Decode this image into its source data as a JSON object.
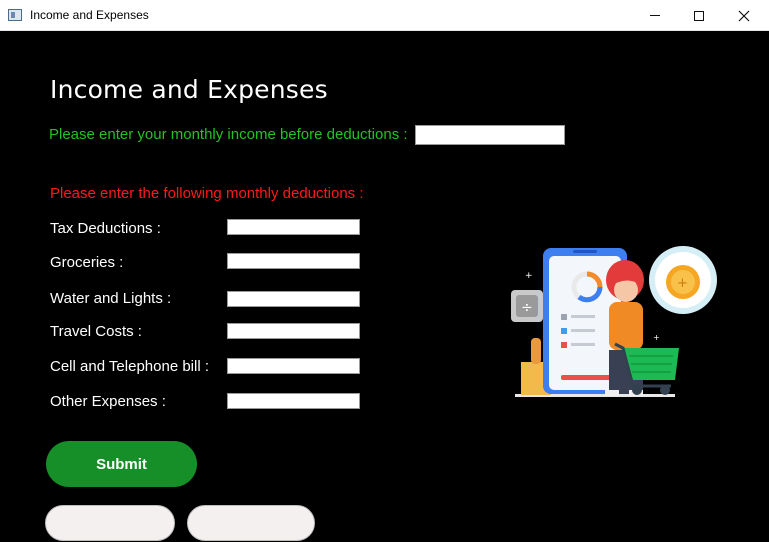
{
  "window": {
    "title": "Income and Expenses"
  },
  "heading": "Income and Expenses",
  "income": {
    "label": "Please enter your monthly income before deductions :",
    "value": ""
  },
  "deductions": {
    "heading": "Please enter the following monthly deductions :",
    "rows": [
      {
        "label": "Tax Deductions :",
        "value": ""
      },
      {
        "label": "Groceries :",
        "value": ""
      },
      {
        "label": "Water and Lights :",
        "value": ""
      },
      {
        "label": "Travel Costs :",
        "value": ""
      },
      {
        "label": "Cell and Telephone bill :",
        "value": ""
      },
      {
        "label": "Other Expenses :",
        "value": ""
      }
    ]
  },
  "buttons": {
    "submit": "Submit",
    "secondary_a": "",
    "secondary_b": ""
  },
  "colors": {
    "background": "#000000",
    "income_label": "#22c322",
    "deduction_heading": "#ff1a1a",
    "submit": "#168f29"
  },
  "icons": {
    "illustration": "finance-app-woman-shopping-illustration"
  }
}
